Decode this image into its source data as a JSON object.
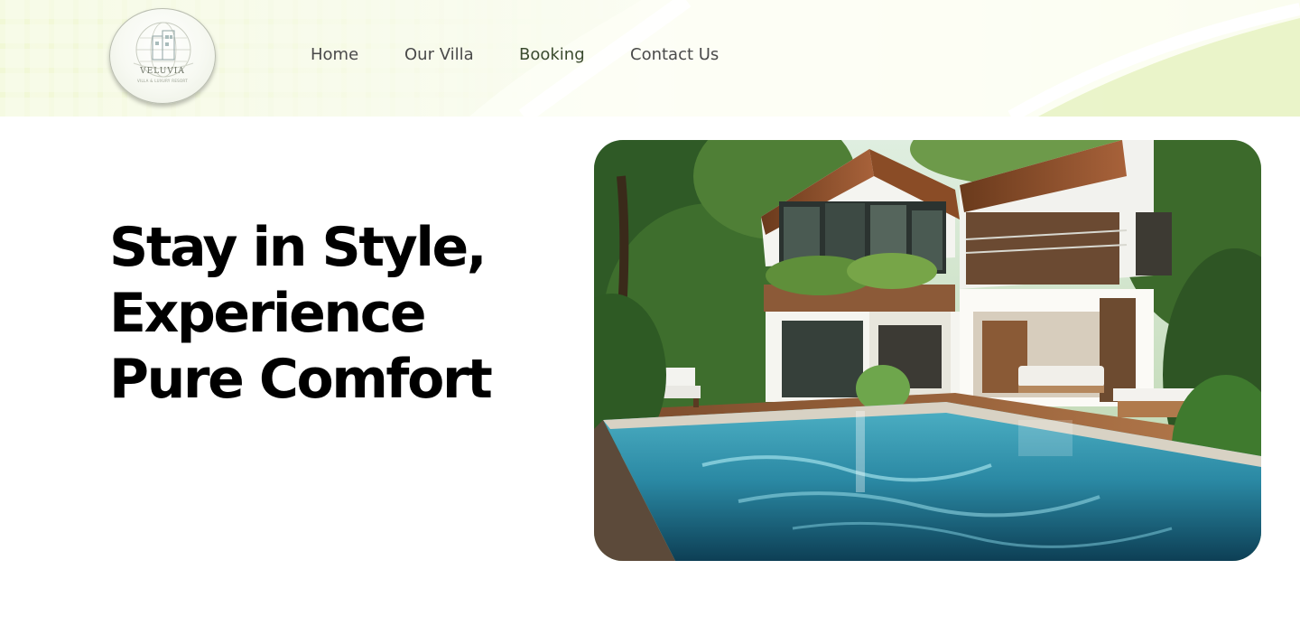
{
  "brand": {
    "logo_name": "VELUVIA",
    "logo_tagline": "VILLA & LUXURY RESORT"
  },
  "nav": {
    "items": [
      {
        "label": "Home"
      },
      {
        "label": "Our Villa"
      },
      {
        "label": "Booking"
      },
      {
        "label": "Contact Us"
      }
    ]
  },
  "hero": {
    "title_lines": [
      "Stay in Style,",
      "Experience",
      "Pure Comfort"
    ],
    "image_icon": "villa-pool-photo"
  },
  "colors": {
    "header_accent": "#e9f4c9",
    "nav_text": "#4a4a4a",
    "title_text": "#000000"
  }
}
